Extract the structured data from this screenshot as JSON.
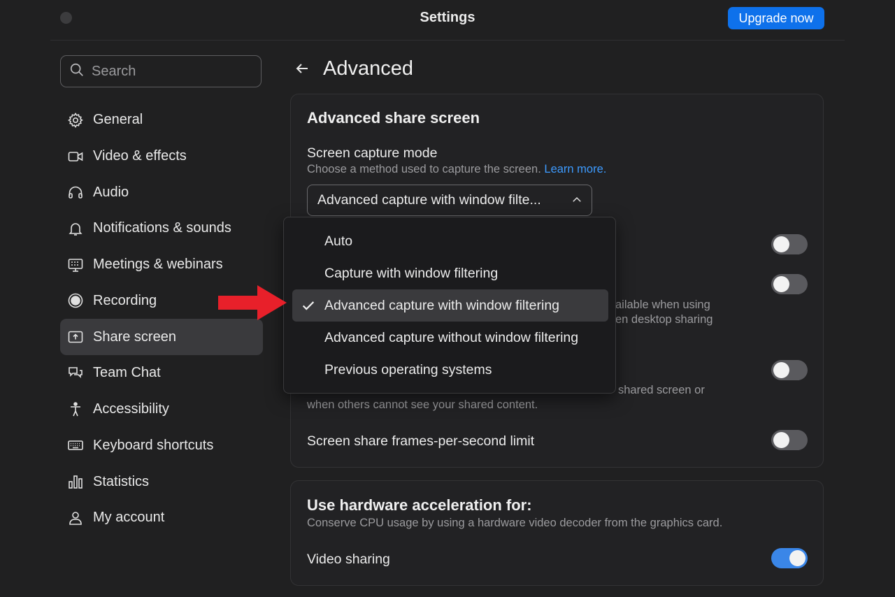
{
  "window": {
    "title": "Settings",
    "upgrade_label": "Upgrade now"
  },
  "search": {
    "placeholder": "Search"
  },
  "sidebar": {
    "items": [
      {
        "label": "General",
        "icon": "gear-icon"
      },
      {
        "label": "Video & effects",
        "icon": "video-camera-icon"
      },
      {
        "label": "Audio",
        "icon": "headphones-icon"
      },
      {
        "label": "Notifications & sounds",
        "icon": "bell-icon"
      },
      {
        "label": "Meetings & webinars",
        "icon": "calendar-grid-icon"
      },
      {
        "label": "Recording",
        "icon": "record-icon"
      },
      {
        "label": "Share screen",
        "icon": "share-screen-icon",
        "active": true
      },
      {
        "label": "Team Chat",
        "icon": "chat-bubbles-icon"
      },
      {
        "label": "Accessibility",
        "icon": "accessibility-icon"
      },
      {
        "label": "Keyboard shortcuts",
        "icon": "keyboard-icon"
      },
      {
        "label": "Statistics",
        "icon": "bar-chart-icon"
      },
      {
        "label": "My account",
        "icon": "person-icon"
      }
    ]
  },
  "main": {
    "page_title": "Advanced",
    "share_section": {
      "heading": "Advanced share screen",
      "capture_mode_label": "Screen capture mode",
      "capture_mode_desc": "Choose a method used to capture the screen.",
      "learn_more": "Learn more.",
      "selected_value": "Advanced capture with window filte...",
      "partial_line1": "ailable when using",
      "partial_line2": "en desktop sharing",
      "partial_desc_line1": "shared screen or",
      "partial_desc_line2": "when others cannot see your shared content.",
      "fps_label": "Screen share frames-per-second limit"
    },
    "hardware_section": {
      "heading": "Use hardware acceleration for:",
      "desc": "Conserve CPU usage by using a hardware video decoder from the graphics card.",
      "video_sharing_label": "Video sharing"
    }
  },
  "dropdown": {
    "options": [
      {
        "label": "Auto"
      },
      {
        "label": "Capture with window filtering"
      },
      {
        "label": "Advanced capture with window filtering",
        "selected": true
      },
      {
        "label": "Advanced capture without window filtering"
      },
      {
        "label": "Previous operating systems"
      }
    ]
  },
  "toggles": {
    "toggle_1": false,
    "toggle_2": false,
    "toggle_3": false,
    "fps_limit": false,
    "video_sharing": true
  },
  "colors": {
    "accent": "#0e71eb",
    "link": "#3d9bff",
    "arrow": "#e8202a",
    "background": "#202021"
  }
}
